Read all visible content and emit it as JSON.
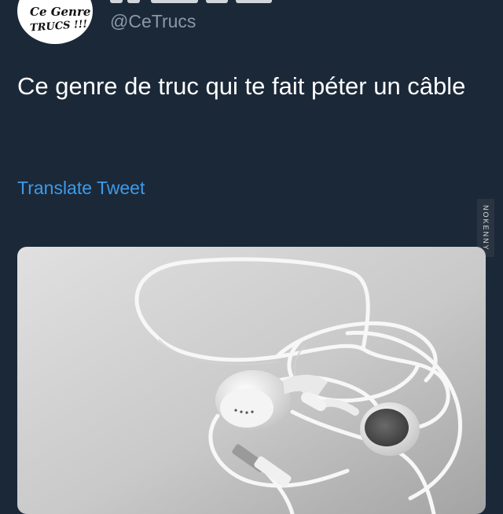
{
  "author": {
    "avatar_text": [
      "Ce Genre",
      "TRUCS !!!"
    ],
    "handle": "@CeTrucs"
  },
  "tweet": {
    "text": "Ce genre de truc qui te fait péter un câble",
    "translate_label": "Translate Tweet"
  },
  "media": {
    "description": "Tangled white earbuds with cable on a grey surface",
    "watermark": "NOKENNY"
  },
  "colors": {
    "background": "#1b2838",
    "text": "#ffffff",
    "handle": "#8899a6",
    "link": "#3d9be9"
  }
}
